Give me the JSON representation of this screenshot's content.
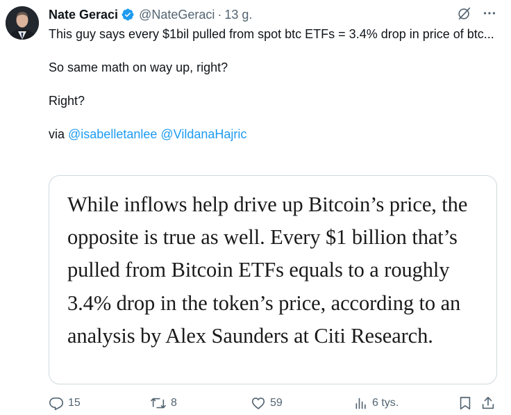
{
  "author": {
    "display_name": "Nate Geraci",
    "handle": "@NateGeraci",
    "separator": "·",
    "time": "13 g."
  },
  "tweet": {
    "line1": "This guy says every $1bil pulled from spot btc ETFs = 3.4% drop in price of btc...",
    "line2": "So same math on way up, right?",
    "line3": "Right?",
    "via_prefix": "via ",
    "mention1": "@isabelletanlee",
    "mention2": "@VildanaHajric"
  },
  "quote_image": {
    "text": "While inflows help drive up Bitcoin’s price, the opposite is true as well. Every $1 billion that’s pulled from Bitcoin ETFs equals to a roughly 3.4% drop in the token’s price, according to an analysis by Alex Saunders at Citi Research."
  },
  "actions": {
    "replies": "15",
    "reposts": "8",
    "likes": "59",
    "views": "6 tys."
  },
  "colors": {
    "accent": "#1d9bf0",
    "secondary_text": "#536471",
    "border": "#cfd9de"
  },
  "icons": [
    "verified-badge-icon",
    "grok-icon",
    "more-icon",
    "reply-icon",
    "repost-icon",
    "like-icon",
    "views-icon",
    "bookmark-icon",
    "share-icon"
  ]
}
